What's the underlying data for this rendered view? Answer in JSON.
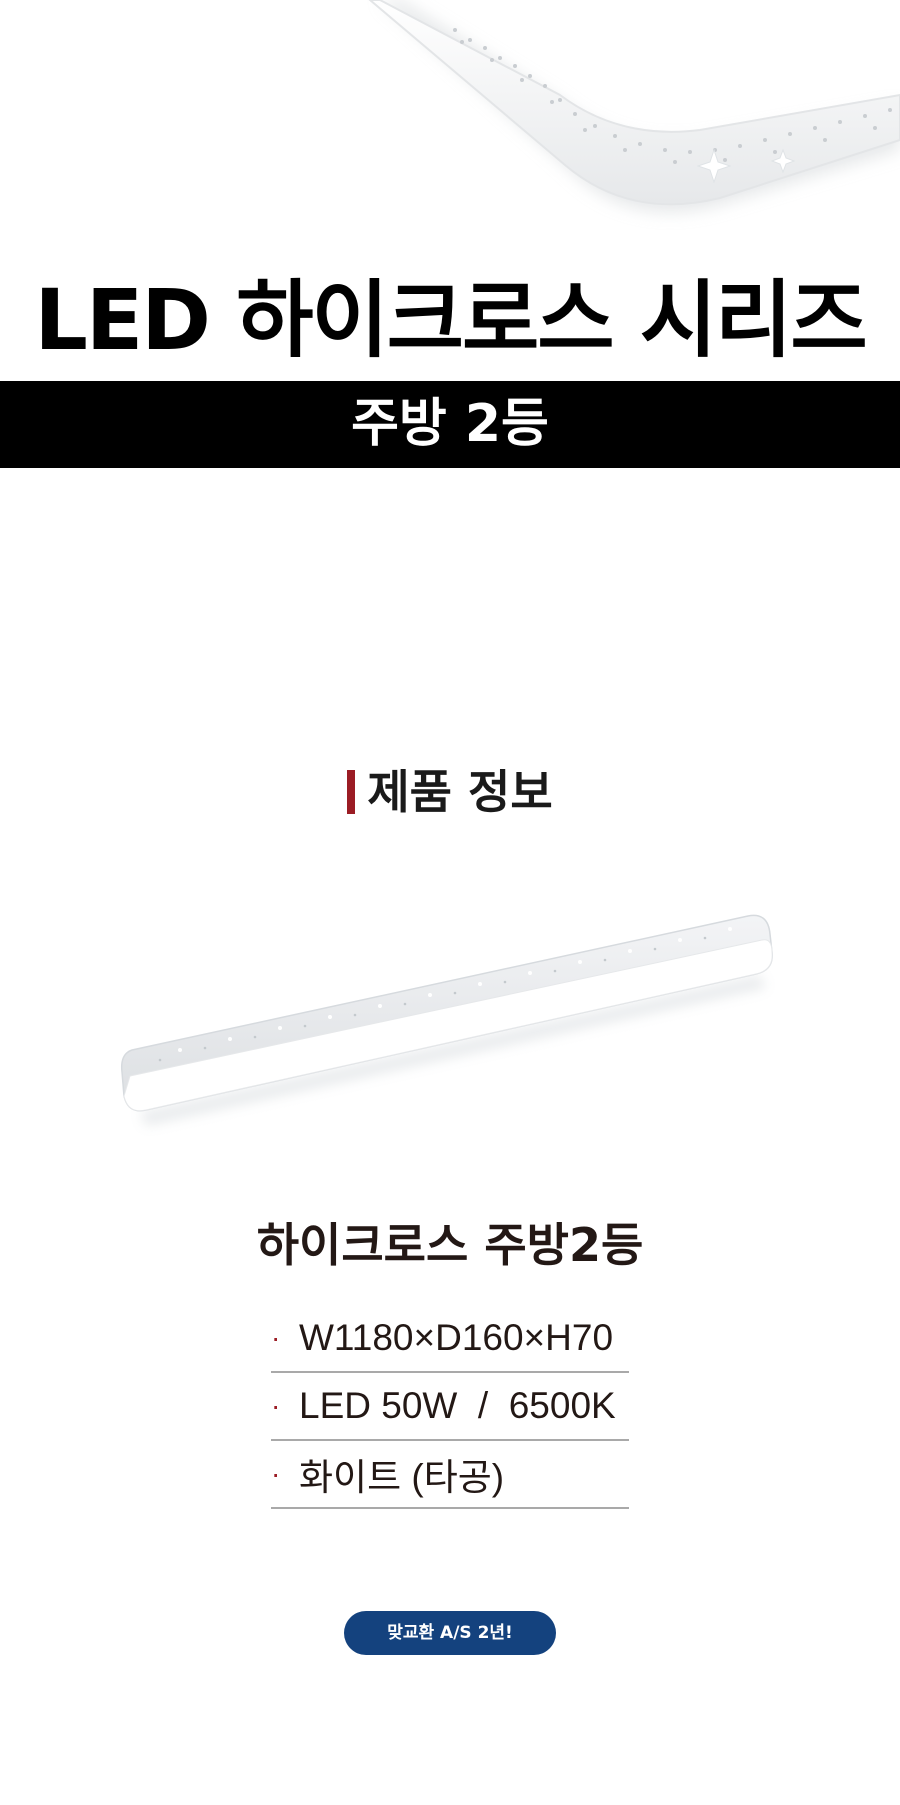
{
  "hero": {
    "title": "LED 하이크로스 시리즈",
    "subtitle": "주방 2등"
  },
  "section": {
    "title": "제품 정보",
    "accent_color": "#9b1c24"
  },
  "product": {
    "name": "하이크로스 주방2등",
    "specs": [
      "W1180×D160×H70",
      "LED 50W  /  6500K",
      "화이트 (타공)"
    ]
  },
  "badge": {
    "label": "맞교환 A/S 2년!",
    "color": "#14427e"
  },
  "images": {
    "hero_image": "ceiling-lamp-closeup",
    "product_image": "kitchen-led-bar-lamp"
  }
}
